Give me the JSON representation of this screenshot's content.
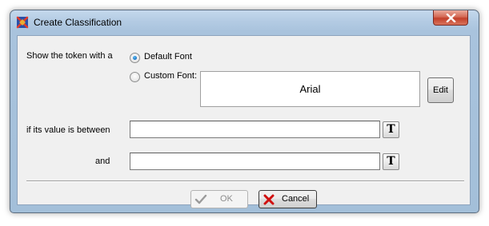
{
  "window": {
    "title": "Create Classification",
    "close_icon": "close-icon",
    "app_icon": "classification-app-icon"
  },
  "form": {
    "show_label": "Show the token with a",
    "default_font_label": "Default Font",
    "default_font_selected": true,
    "custom_font_label": "Custom Font:",
    "custom_font_selected": false,
    "font_preview": "Arial",
    "edit_label": "Edit",
    "between_label": "if its value is between",
    "between_value": "",
    "and_label": "and",
    "and_value": "",
    "text_button_glyph": "T"
  },
  "buttons": {
    "ok_label": "OK",
    "ok_enabled": false,
    "cancel_label": "Cancel"
  },
  "colors": {
    "title_bar": "#b3cbe3",
    "client_bg": "#f0f0f0",
    "close_button": "#c2402a",
    "cancel_icon": "#d01010",
    "ok_icon_disabled": "#9a9a9a"
  }
}
